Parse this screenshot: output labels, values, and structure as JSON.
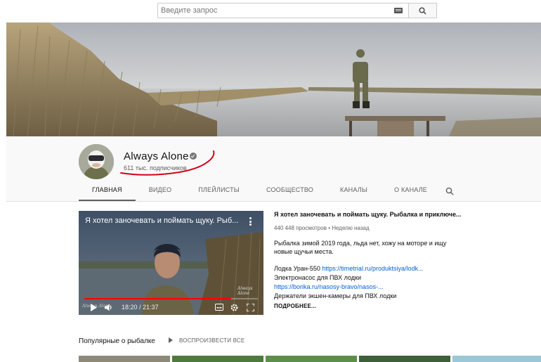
{
  "search": {
    "placeholder": "Введите запрос",
    "icons": [
      "keyboard-icon",
      "search-icon"
    ]
  },
  "channel": {
    "name": "Always Alone",
    "subscribers": "611 тыс. подписчиков",
    "verified_icon": "verified-check-icon"
  },
  "tabs": [
    {
      "label": "ГЛАВНАЯ",
      "active": true
    },
    {
      "label": "ВИДЕО"
    },
    {
      "label": "ПЛЕЙЛИСТЫ"
    },
    {
      "label": "СООБЩЕСТВО"
    },
    {
      "label": "КАНАЛЫ"
    },
    {
      "label": "О КАНАЛЕ"
    }
  ],
  "player": {
    "title": "Я хотел заночевать и поймать щуку. Рыб...",
    "time": "18:20 / 21:37",
    "watermark": "Always Alone",
    "progress": 0.848
  },
  "video": {
    "title": "Я хотел заночевать и поймать щуку. Рыбалка и приключе...",
    "views": "440 448 просмотров",
    "separator": "•",
    "date": "Неделю назад",
    "description": "Рыбалка зимой 2019 года, льда нет, хожу на моторе и ищу новые щучьи места.",
    "lines": [
      {
        "text": "Лодка Уран-550 ",
        "link": "https://timetrial.ru/produktsiya/lodk..."
      },
      {
        "text": "Электронасос для ПВХ лодки",
        "link": ""
      },
      {
        "text": "",
        "link": "https://borika.ru/nasosy-bravo/nasos-..."
      },
      {
        "text": "Держатели экшен-камеры для ПВХ лодки",
        "link": ""
      }
    ],
    "more": "ПОДРОБНЕЕ..."
  },
  "shelf": {
    "title": "Популярные о рыбалке",
    "play_all": "ВОСПРОИЗВЕСТИ ВСЕ"
  },
  "colors": {
    "accent_red": "#ff0000",
    "link_blue": "#065fd4",
    "annotation_red": "#d4001a"
  }
}
